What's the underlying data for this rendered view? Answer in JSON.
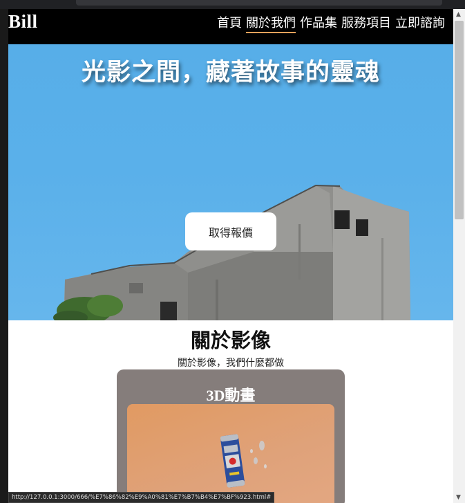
{
  "site": {
    "brand": "Bill"
  },
  "nav": {
    "items": [
      {
        "label": "首頁"
      },
      {
        "label": "關於我們"
      },
      {
        "label": "作品集"
      },
      {
        "label": "服務項目"
      },
      {
        "label": "立即諮詢"
      }
    ],
    "active_index": 1
  },
  "hero": {
    "title": "光影之間，藏著故事的靈魂",
    "cta_label": "取得報價"
  },
  "about": {
    "title": "關於影像",
    "subtitle": "關於影像，我們什麼都做"
  },
  "card": {
    "title": "3D動畫",
    "image_icon": "soda-can-splash-image"
  },
  "statusbar": {
    "url": "http://127.0.0.1:3000/666/%E7%86%82%E9%A0%81%E7%B7%B4%E7%BF%923.html#"
  },
  "colors": {
    "navbar_bg": "#000000",
    "active_underline": "#e6a15a",
    "sky": "#5ab0ea",
    "card_bg": "#857d7b",
    "card_image_bg": "#e19a62"
  }
}
